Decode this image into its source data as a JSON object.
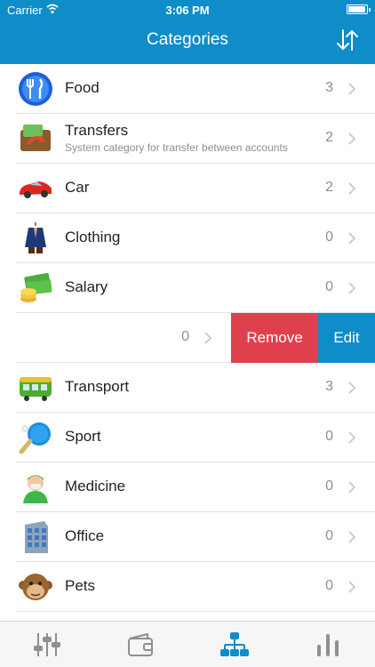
{
  "status_bar": {
    "carrier": "Carrier",
    "time": "3:06 PM"
  },
  "nav": {
    "title": "Categories",
    "sort_icon": "sort-arrows-icon"
  },
  "categories": [
    {
      "name": "Food",
      "subtitle": "",
      "count": "3",
      "icon": "food-icon"
    },
    {
      "name": "Transfers",
      "subtitle": "System category for transfer between accounts",
      "count": "2",
      "icon": "transfers-icon"
    },
    {
      "name": "Car",
      "subtitle": "",
      "count": "2",
      "icon": "car-icon"
    },
    {
      "name": "Clothing",
      "subtitle": "",
      "count": "0",
      "icon": "clothing-icon"
    },
    {
      "name": "Salary",
      "subtitle": "",
      "count": "0",
      "icon": "salary-icon"
    },
    {
      "name": "",
      "subtitle": "",
      "count": "0",
      "icon": ""
    },
    {
      "name": "Transport",
      "subtitle": "",
      "count": "3",
      "icon": "transport-icon"
    },
    {
      "name": "Sport",
      "subtitle": "",
      "count": "0",
      "icon": "sport-icon"
    },
    {
      "name": "Medicine",
      "subtitle": "",
      "count": "0",
      "icon": "medicine-icon"
    },
    {
      "name": "Office",
      "subtitle": "",
      "count": "0",
      "icon": "office-icon"
    },
    {
      "name": "Pets",
      "subtitle": "",
      "count": "0",
      "icon": "pets-icon"
    }
  ],
  "swipe_actions": {
    "remove": "Remove",
    "edit": "Edit"
  },
  "tabs": [
    {
      "icon": "settings-sliders-icon"
    },
    {
      "icon": "wallet-icon"
    },
    {
      "icon": "categories-tree-icon",
      "active": true
    },
    {
      "icon": "reports-chart-icon"
    }
  ],
  "colors": {
    "brand": "#0e8dc8",
    "remove": "#e0404e",
    "secondary_text": "#8e8e93"
  }
}
